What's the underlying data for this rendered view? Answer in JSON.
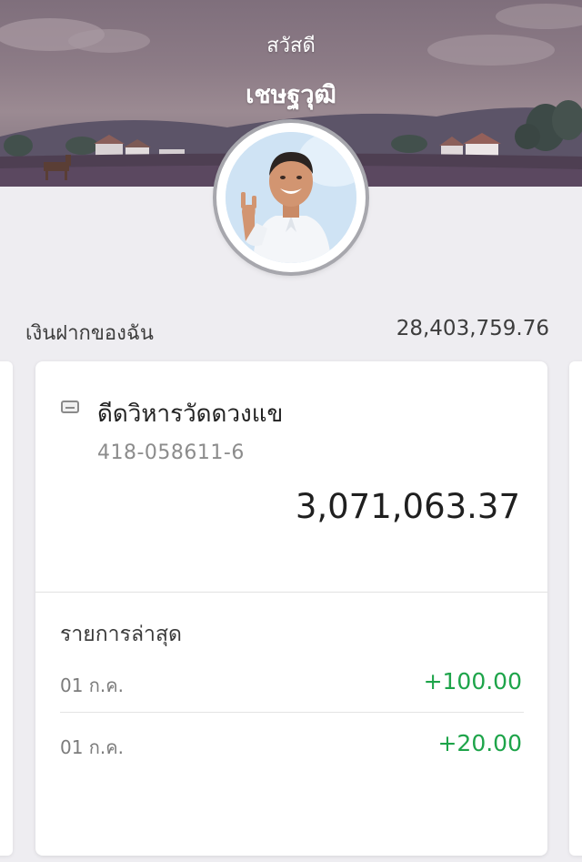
{
  "header": {
    "greeting": "สวัสดี",
    "user_name": "เชษฐวุฒิ"
  },
  "summary": {
    "deposit_label": "เงินฝากของฉัน",
    "deposit_total": "28,403,759.76"
  },
  "account_card": {
    "icon": "bank-card-icon",
    "account_name": "ดีดวิหารวัดดวงแข",
    "account_number": "418-058611-6",
    "balance": "3,071,063.37",
    "recent_title": "รายการล่าสุด",
    "transactions": [
      {
        "date": "01 ก.ค.",
        "amount": "+100.00"
      },
      {
        "date": "01 ก.ค.",
        "amount": "+20.00"
      }
    ]
  },
  "colors": {
    "positive_amount": "#1ea44a",
    "page_background": "#eeedf1"
  }
}
